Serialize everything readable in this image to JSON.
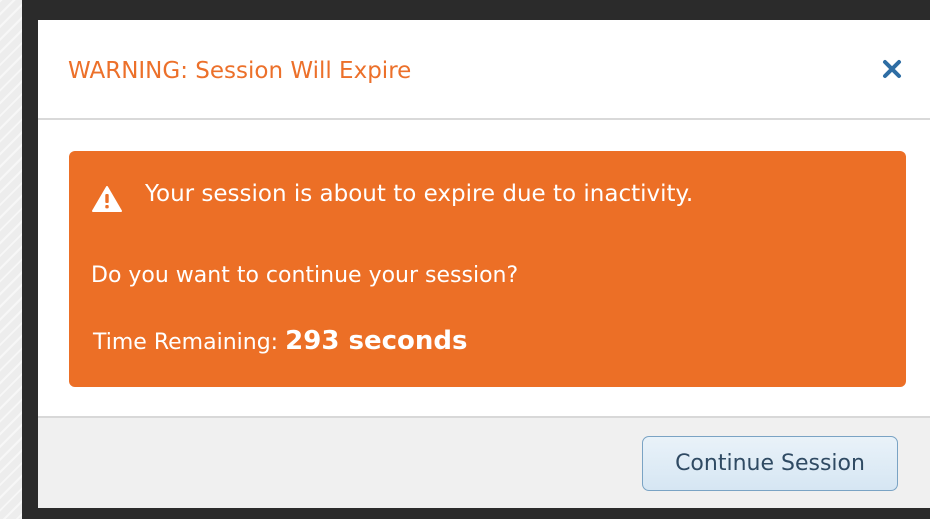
{
  "dialog": {
    "title": "WARNING: Session Will Expire",
    "close_icon": "close-icon",
    "title_color": "#ec702a"
  },
  "alert": {
    "icon": "warning-icon",
    "background_color": "#ec6f26",
    "message": "Your session is about to expire due to inactivity.",
    "question": "Do you want to continue your session?",
    "time_label": "Time Remaining:",
    "time_value": "293 seconds"
  },
  "footer": {
    "continue_label": "Continue Session"
  }
}
